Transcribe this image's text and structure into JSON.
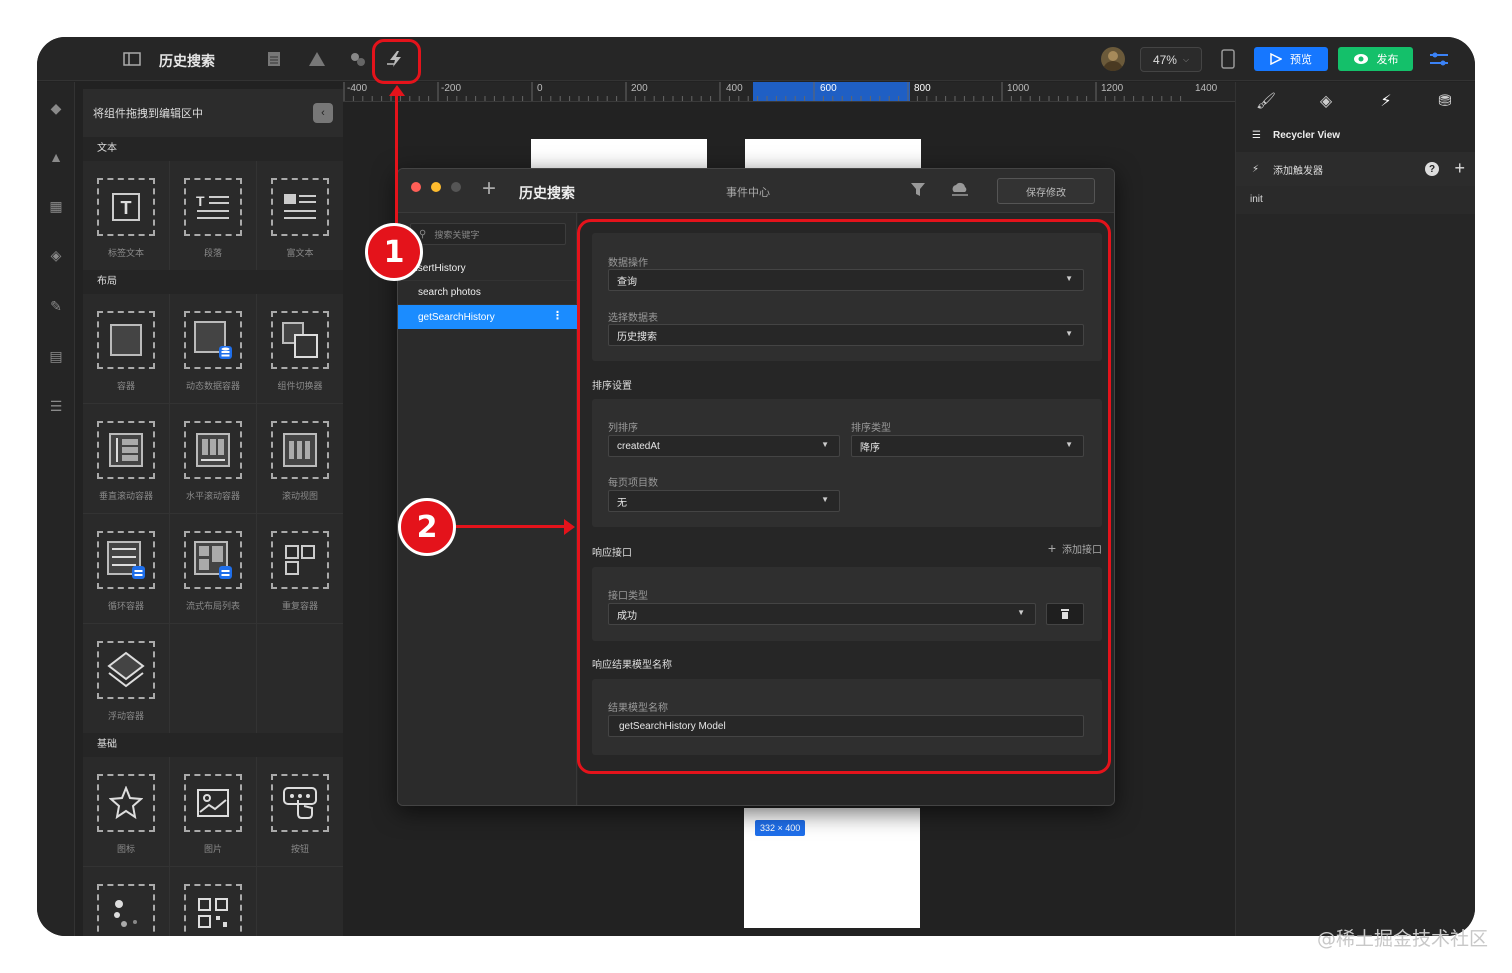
{
  "toolbar": {
    "title": "历史搜索",
    "zoom": "47%",
    "preview": "预览",
    "publish": "发布",
    "colors": {
      "preview": "#1677ff",
      "publish": "#14c06a"
    }
  },
  "left_panel": {
    "header": "将组件拖拽到编辑区中",
    "sections": [
      {
        "title": "文本",
        "items": [
          "标签文本",
          "段落",
          "富文本"
        ]
      },
      {
        "title": "布局",
        "items": [
          "容器",
          "动态数据容器",
          "组件切换器",
          "垂直滚动容器",
          "水平滚动容器",
          "滚动视图",
          "循环容器",
          "流式布局列表",
          "重复容器",
          "浮动容器"
        ]
      },
      {
        "title": "基础",
        "items": [
          "图标",
          "图片",
          "按钮"
        ]
      }
    ]
  },
  "ruler": {
    "labels": [
      "-400",
      "-200",
      "0",
      "200",
      "400",
      "600",
      "800",
      "1000",
      "1200",
      "1400"
    ]
  },
  "canvas": {
    "size_badge": "332 × 400"
  },
  "right_panel": {
    "component": "Recycler View",
    "add_trigger": "添加触发器",
    "trigger": "init"
  },
  "dialog": {
    "title": "历史搜索",
    "center_title": "事件中心",
    "save": "保存修改",
    "search_placeholder": "搜索关键字",
    "events": [
      "insertHistory",
      "search photos",
      "getSearchHistory"
    ],
    "form": {
      "data_op_label": "数据操作",
      "data_op_value": "查询",
      "table_label": "选择数据表",
      "table_value": "历史搜索",
      "sort_section": "排序设置",
      "sort_col_label": "列排序",
      "sort_col_value": "createdAt",
      "sort_type_label": "排序类型",
      "sort_type_value": "降序",
      "page_size_label": "每页项目数",
      "page_size_value": "无",
      "resp_section": "响应接口",
      "add_iface": "添加接口",
      "iface_type_label": "接口类型",
      "iface_type_value": "成功",
      "model_section": "响应结果模型名称",
      "model_label": "结果模型名称",
      "model_value": "getSearchHistory Model"
    }
  },
  "annotations": {
    "one": "1",
    "two": "2"
  },
  "watermark": "@稀土掘金技术社区"
}
